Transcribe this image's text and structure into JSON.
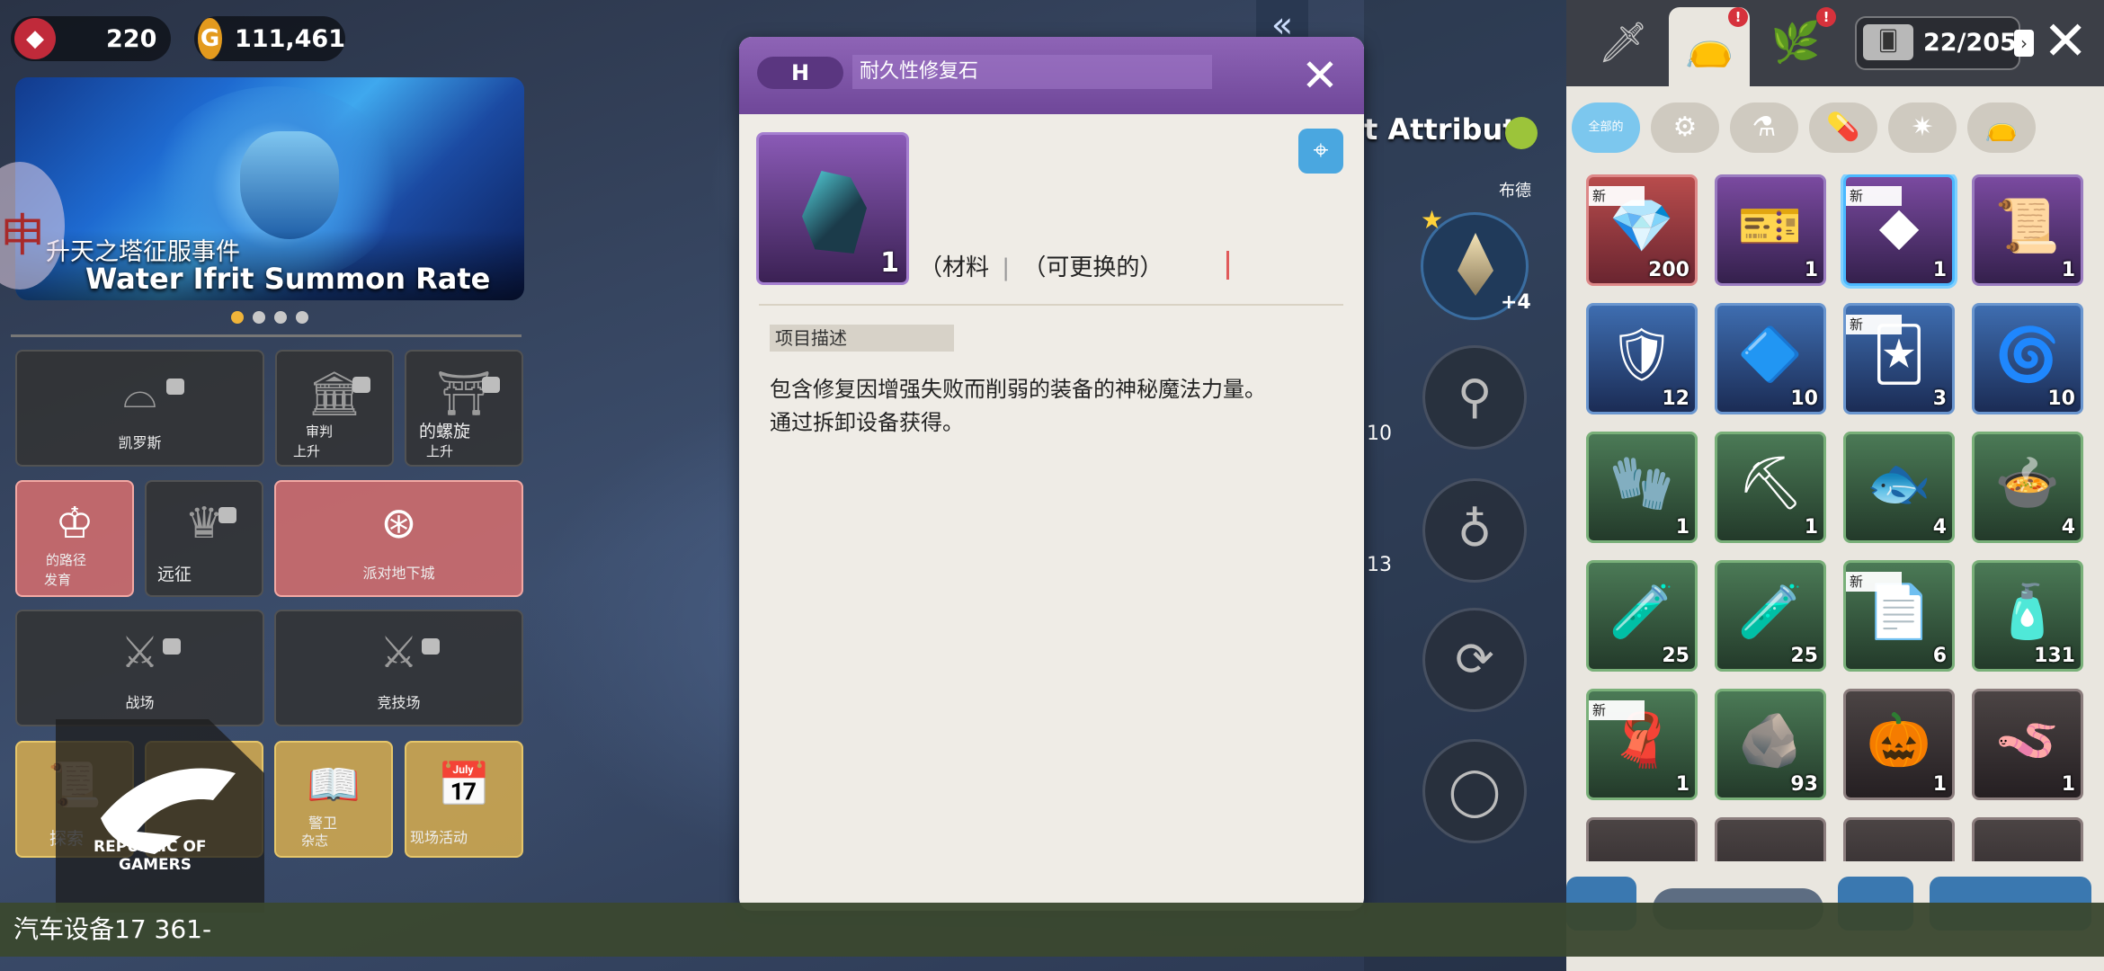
{
  "hud": {
    "gems": "220",
    "gold": "111,461"
  },
  "banner": {
    "subtitle": "升天之塔征服事件",
    "title": "Water Ifrit Summon Rate UP",
    "dots": 4,
    "active_dot": 0
  },
  "menu": {
    "kairos": {
      "label": "凯罗斯"
    },
    "trial": {
      "label": "审判",
      "sub": "上升"
    },
    "spiral": {
      "label": "的螺旋",
      "sub": "上升"
    },
    "growth": {
      "label": "的路径",
      "sub": "发育"
    },
    "expedition": {
      "label": "远征"
    },
    "party_dungeon": {
      "label": "派对地下城"
    },
    "battlefield": {
      "label": "战场"
    },
    "arena": {
      "label": "竞技场"
    },
    "explore": {
      "label": "探索"
    },
    "guard": {
      "label": "警卫",
      "sub": "杂志"
    },
    "live_event": {
      "label": "现场活动"
    }
  },
  "overlay": {
    "rog_line1": "REPUBLIC OF",
    "rog_line2": "GAMERS"
  },
  "status_bar": "汽车设备17 361-",
  "item_dialog": {
    "grade": "H",
    "title": "耐久性修复石",
    "quantity": "1",
    "tag_material": "（材料",
    "tag_exchangeable": "（可更换的）",
    "section_label": "项目描述",
    "description_line1": "包含修复因增强失败而削弱的装备的神秘魔法力量。",
    "description_line2": "通过拆卸设备获得。"
  },
  "middle_panel": {
    "attribute_title": "t Attribute",
    "attribute_sub": "布德",
    "weapon_bonus": "+4",
    "side_counts": [
      "10",
      "13"
    ]
  },
  "inventory": {
    "capacity": "22/205",
    "tabs": [
      "weapon",
      "bag",
      "materials"
    ],
    "tab_badges": [
      "!",
      "!"
    ],
    "filters": [
      "全部的",
      "gear",
      "potion",
      "pill",
      "gem",
      "bag"
    ],
    "new_label": "新",
    "items": [
      {
        "name": "heart-gem",
        "qty": "200",
        "rarity": "red",
        "new": true,
        "icon": "💎"
      },
      {
        "name": "gold-ticket",
        "qty": "1",
        "rarity": "pur",
        "new": false,
        "icon": "🎫"
      },
      {
        "name": "repair-stone",
        "qty": "1",
        "rarity": "pur",
        "new": true,
        "selected": true,
        "icon": "◆"
      },
      {
        "name": "scroll-gold",
        "qty": "1",
        "rarity": "pur",
        "new": false,
        "icon": "📜"
      },
      {
        "name": "red-crest",
        "qty": "12",
        "rarity": "blu",
        "new": false,
        "icon": "🛡"
      },
      {
        "name": "blue-crystal",
        "qty": "10",
        "rarity": "blu",
        "new": false,
        "icon": "🔷"
      },
      {
        "name": "rune-card",
        "qty": "3",
        "rarity": "blu",
        "new": true,
        "icon": "🃏"
      },
      {
        "name": "pink-vortex",
        "qty": "10",
        "rarity": "blu",
        "new": false,
        "icon": "🌀"
      },
      {
        "name": "leather-glove",
        "qty": "1",
        "rarity": "grn",
        "new": false,
        "icon": "🧤"
      },
      {
        "name": "pickaxe",
        "qty": "1",
        "rarity": "grn",
        "new": false,
        "icon": "⛏"
      },
      {
        "name": "fish-platter",
        "qty": "4",
        "rarity": "grn",
        "new": false,
        "icon": "🐟"
      },
      {
        "name": "food-bowl",
        "qty": "4",
        "rarity": "grn",
        "new": false,
        "icon": "🍲"
      },
      {
        "name": "red-potion",
        "qty": "25",
        "rarity": "grn",
        "new": false,
        "icon": "🧪"
      },
      {
        "name": "green-potion",
        "qty": "25",
        "rarity": "grn",
        "new": false,
        "icon": "🧪"
      },
      {
        "name": "paper-scroll",
        "qty": "6",
        "rarity": "grn",
        "new": true,
        "icon": "📄"
      },
      {
        "name": "blue-vial",
        "qty": "131",
        "rarity": "grn",
        "new": false,
        "icon": "🧴"
      },
      {
        "name": "teal-cloth",
        "qty": "1",
        "rarity": "grn",
        "new": true,
        "icon": "🧣"
      },
      {
        "name": "rune-stone",
        "qty": "93",
        "rarity": "grn",
        "new": false,
        "icon": "🪨"
      },
      {
        "name": "brown-seed",
        "qty": "1",
        "rarity": "dk",
        "new": false,
        "icon": "🎃"
      },
      {
        "name": "earthworm",
        "qty": "1",
        "rarity": "dk",
        "new": false,
        "icon": "🪱"
      }
    ]
  }
}
